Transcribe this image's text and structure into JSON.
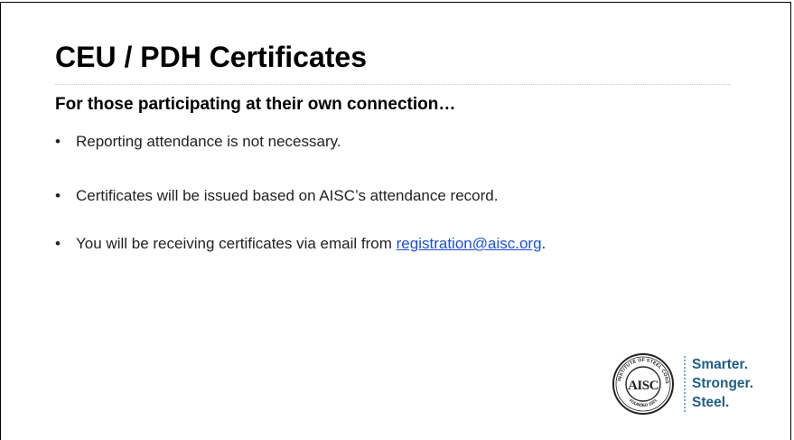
{
  "slide": {
    "title": "CEU / PDH Certificates",
    "subtitle": "For those participating at their own connection…",
    "bullet_symbol": "•",
    "bullets": [
      {
        "text": "Reporting attendance is not necessary."
      },
      {
        "text": "Certificates will be issued based on AISC’s attendance record."
      },
      {
        "text_before": "You will be receiving certificates via email from ",
        "link": "registration@aisc.org",
        "text_after": "."
      }
    ]
  },
  "logo": {
    "seal_letters": "AISC",
    "seal_ring_text": "AMERICAN INSTITUTE OF STEEL CONSTRUCTION",
    "seal_founded": "FOUNDED 1921",
    "tagline": [
      "Smarter.",
      "Stronger.",
      "Steel."
    ]
  },
  "colors": {
    "link": "#1a4fd6",
    "tagline": "#1f5e86",
    "seal": "#222222"
  }
}
